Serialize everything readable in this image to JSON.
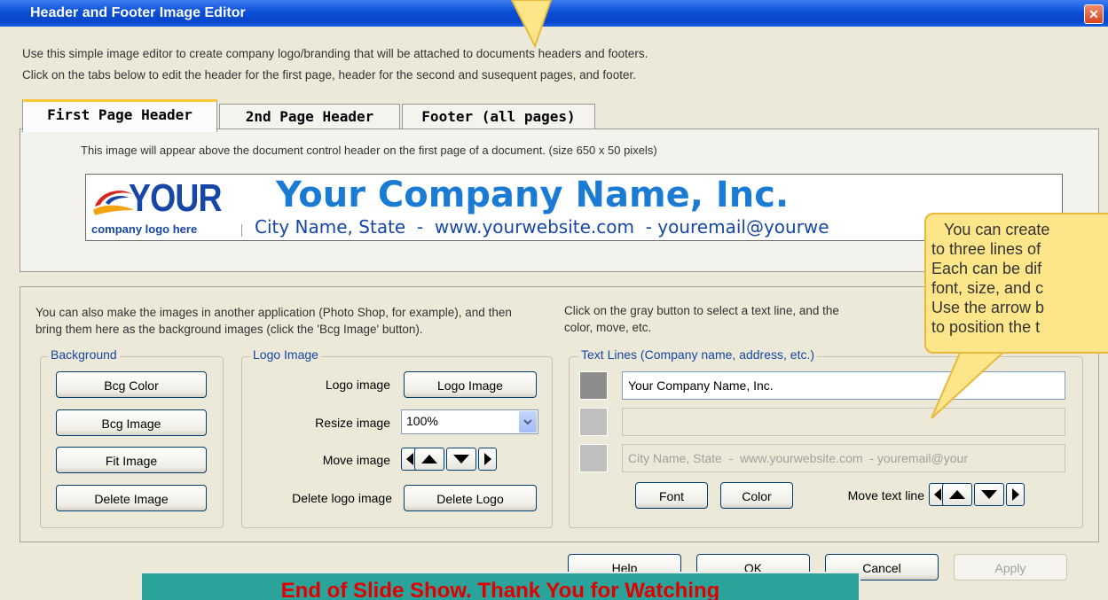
{
  "window": {
    "title": "Header and Footer Image Editor",
    "close_glyph": "✕"
  },
  "intro": {
    "line1": "Use this simple image editor to create company logo/branding that will be attached to documents headers and footers.",
    "line2": "Click on the tabs below to edit the header for the first page, header for the second and susequent pages, and footer."
  },
  "tabs": [
    {
      "label": "First Page Header",
      "active": true
    },
    {
      "label": "2nd Page Header",
      "active": false
    },
    {
      "label": "Footer (all pages)",
      "active": false
    }
  ],
  "tab_panel": {
    "description": "This image will appear above the document control header on the first page of a document. (size 650 x 50 pixels)"
  },
  "banner": {
    "logo_word": "YOUR",
    "logo_caption": "company logo here",
    "company_name": "Your Company Name, Inc.",
    "contact_line": "City Name, State  -  www.yourwebsite.com  - youremail@yourwe"
  },
  "lower": {
    "left_text": "You can also make the images in another application (Photo Shop, for example), and then bring them here as the background images (click the 'Bcg Image' button).",
    "right_text1": "Click on the gray button to select a text line, and the",
    "right_text2": "color, move, etc."
  },
  "background_group": {
    "legend": "Background",
    "buttons": [
      "Bcg Color",
      "Bcg Image",
      "Fit Image",
      "Delete Image"
    ]
  },
  "logo_group": {
    "legend": "Logo Image",
    "logo_image_label": "Logo image",
    "logo_image_button": "Logo Image",
    "resize_label": "Resize image",
    "resize_value": "100%",
    "move_label": "Move image",
    "delete_label": "Delete logo image",
    "delete_button": "Delete Logo"
  },
  "text_group": {
    "legend": "Text Lines (Company name, address, etc.)",
    "line1": "Your Company Name, Inc.",
    "line2": "",
    "line3": "City Name, State  -  www.yourwebsite.com  - youremail@your",
    "font_button": "Font",
    "color_button": "Color",
    "move_label": "Move text line"
  },
  "footer_buttons": {
    "help": "Help",
    "ok": "OK",
    "cancel": "Cancel",
    "apply": "Apply"
  },
  "callout": {
    "lines": [
      "You can create",
      "to three lines of",
      "Each can be dif",
      "font, size, and c",
      "Use the arrow b",
      "to position the t"
    ]
  },
  "slide_banner": {
    "text": "End of Slide Show.  Thank You for Watching"
  },
  "colors": {
    "title_bar": "#0a4fd6",
    "company_name": "#1a7bd4",
    "banner_text": "#e00000",
    "banner_bg": "#2aa39a",
    "callout_bg": "#fde68a"
  }
}
